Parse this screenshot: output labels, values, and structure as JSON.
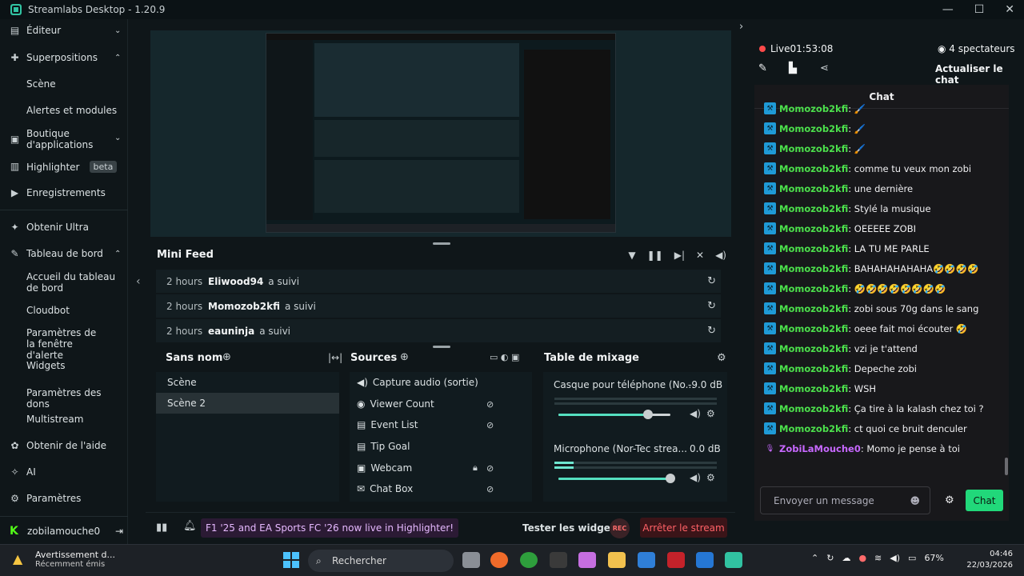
{
  "window": {
    "title": "Streamlabs Desktop - 1.20.9"
  },
  "sidebar": {
    "items": [
      {
        "label": "Éditeur",
        "icon": "pencil-icon"
      },
      {
        "label": "Superpositions",
        "icon": "layers-icon"
      },
      {
        "label": "Scène"
      },
      {
        "label": "Alertes et modules"
      },
      {
        "label": "Boutique d'applications",
        "icon": "store-icon"
      },
      {
        "label": "Highlighter",
        "icon": "highlighter-icon",
        "badge": "beta"
      },
      {
        "label": "Enregistrements",
        "icon": "play-icon"
      },
      {
        "label": "Obtenir Ultra",
        "icon": "ultra-icon"
      },
      {
        "label": "Tableau de bord",
        "icon": "wrench-icon"
      },
      {
        "label": "Accueil du tableau de bord"
      },
      {
        "label": "Cloudbot"
      },
      {
        "label": "Paramètres de la fenêtre d'alerte"
      },
      {
        "label": "Widgets"
      },
      {
        "label": "Paramètres des dons"
      },
      {
        "label": "Multistream"
      },
      {
        "label": "Obtenir de l'aide",
        "icon": "help-icon"
      },
      {
        "label": "AI",
        "icon": "sparkle-icon"
      },
      {
        "label": "Paramètres",
        "icon": "gear-icon"
      }
    ],
    "user": "zobilamouche0"
  },
  "minifeed": {
    "title": "Mini Feed",
    "rows": [
      {
        "time": "2 hours",
        "user": "Eliwood94",
        "action": "a suivi"
      },
      {
        "time": "2 hours",
        "user": "Momozob2kfi",
        "action": "a suivi"
      },
      {
        "time": "2 hours",
        "user": "eauninja",
        "action": "a suivi"
      }
    ]
  },
  "scenes": {
    "title": "Sans nom",
    "items": [
      "Scène",
      "Scène 2"
    ]
  },
  "sources": {
    "title": "Sources",
    "items": [
      {
        "label": "Capture audio (sortie)",
        "icon": "speaker-icon"
      },
      {
        "label": "Viewer Count",
        "icon": "eye-icon"
      },
      {
        "label": "Event List",
        "icon": "list-icon"
      },
      {
        "label": "Tip Goal",
        "icon": "goal-icon"
      },
      {
        "label": "Webcam",
        "icon": "camera-icon"
      },
      {
        "label": "Chat Box",
        "icon": "chat-icon"
      }
    ]
  },
  "mixer": {
    "title": "Table de mixage",
    "channels": [
      {
        "name": "Casque pour téléphone (No...",
        "db": "-9.0 dB",
        "level": 0.8
      },
      {
        "name": "Microphone (Nor-Tec strea...",
        "db": "0.0 dB",
        "level": 1.0
      }
    ]
  },
  "footer": {
    "promo": "F1 '25 and EA Sports FC '26 now live in Highlighter!",
    "test_widgets": "Tester les widgets",
    "rec": "REC",
    "stop": "Arrêter le stream"
  },
  "stream": {
    "live": "Live",
    "timer": "01:53:08",
    "viewers": "4 spectateurs",
    "refresh_chat": "Actualiser le chat"
  },
  "chat": {
    "title": "Chat",
    "messages": [
      {
        "user": "Momozob2kfi",
        "text": "🖌️"
      },
      {
        "user": "Momozob2kfi",
        "text": "🖌️"
      },
      {
        "user": "Momozob2kfi",
        "text": "🖌️"
      },
      {
        "user": "Momozob2kfi",
        "text": "comme tu veux mon zobi"
      },
      {
        "user": "Momozob2kfi",
        "text": "une dernière"
      },
      {
        "user": "Momozob2kfi",
        "text": "Stylé la musique"
      },
      {
        "user": "Momozob2kfi",
        "text": "OEEEEE ZOBI"
      },
      {
        "user": "Momozob2kfi",
        "text": "LA TU ME PARLE"
      },
      {
        "user": "Momozob2kfi",
        "text": "BAHAHAHAHAHA🤣🤣🤣🤣"
      },
      {
        "user": "Momozob2kfi",
        "text": "🤣🤣🤣🤣🤣🤣🤣🤣"
      },
      {
        "user": "Momozob2kfi",
        "text": "zobi sous 70g dans le sang"
      },
      {
        "user": "Momozob2kfi",
        "text": "oeee fait moi écouter 🤣"
      },
      {
        "user": "Momozob2kfi",
        "text": "vzi je t'attend"
      },
      {
        "user": "Momozob2kfi",
        "text": "Depeche zobi"
      },
      {
        "user": "Momozob2kfi",
        "text": "WSH"
      },
      {
        "user": "Momozob2kfi",
        "text": "Ça tire à la kalash chez toi ?"
      },
      {
        "user": "Momozob2kfi",
        "text": "ct quoi ce bruit denculer"
      },
      {
        "user": "ZobiLaMouche0",
        "text": "Momo je pense à toi"
      }
    ],
    "input_placeholder": "Envoyer un message",
    "send_label": "Chat"
  },
  "taskbar": {
    "notif_title": "Avertissement d...",
    "notif_sub": "Récemment émis",
    "search": "Rechercher",
    "battery": "67%",
    "time": "04:46",
    "date": "22/03/2026"
  },
  "colors": {
    "accent": "#31c3a2",
    "live": "#ff4a4a",
    "chat_user": "#4ce04c",
    "stop": "#ff6166"
  }
}
